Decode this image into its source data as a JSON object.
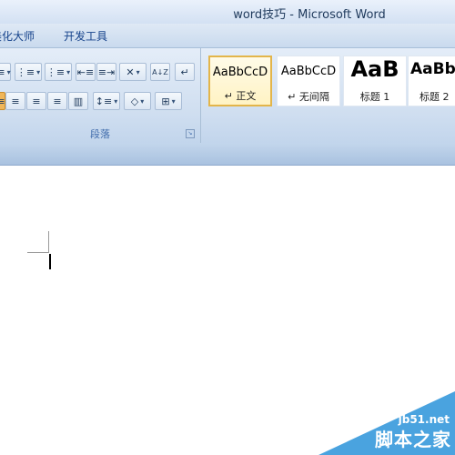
{
  "window": {
    "title": "word技巧 - Microsoft Word"
  },
  "menu": {
    "tabs": [
      "美化大师",
      "开发工具"
    ]
  },
  "paragraph_group": {
    "label": "段落",
    "launcher_glyph": "↘"
  },
  "toolbar": {
    "row1": [
      "≡",
      "⋮≡",
      "⋮≡",
      "⇤≡",
      "≡⇥",
      "✕",
      "A↓Z",
      "↵"
    ],
    "row2": [
      "≡",
      "≡",
      "≡",
      "≡",
      "▥",
      "↕≡",
      "◇",
      "⊞"
    ]
  },
  "styles": [
    {
      "sample": "AaBbCcD",
      "name": "↵ 正文",
      "selected": true
    },
    {
      "sample": "AaBbCcD",
      "name": "↵ 无间隔",
      "selected": false
    },
    {
      "sample": "AaB",
      "name": "标题 1",
      "selected": false
    },
    {
      "sample": "AaBb",
      "name": "标题 2",
      "selected": false
    }
  ],
  "watermark": {
    "site": "jb51.net",
    "cn": "脚本之家"
  }
}
